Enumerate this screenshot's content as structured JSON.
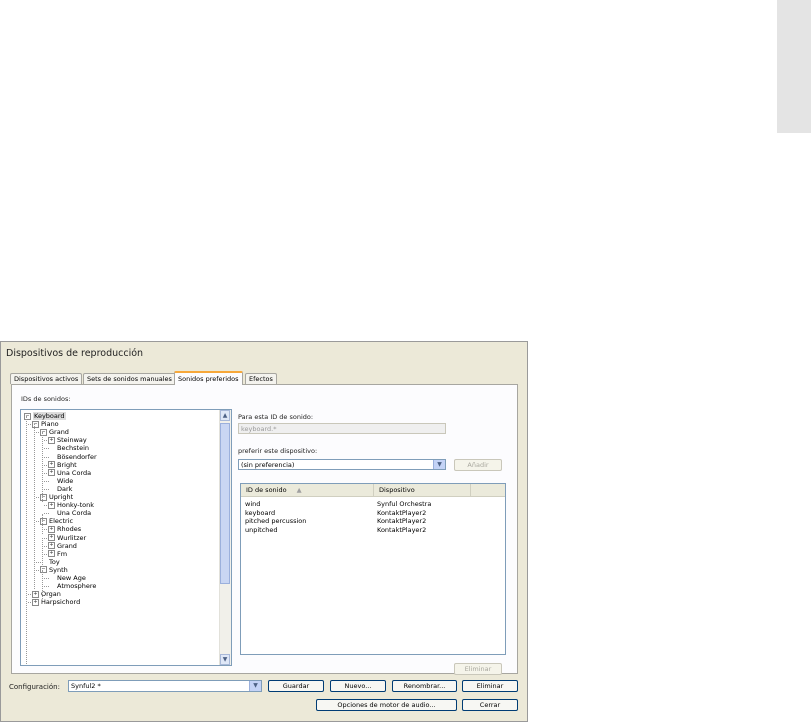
{
  "dialog": {
    "title": "Dispositivos de reproducción",
    "tabs": [
      {
        "label": "Dispositivos activos",
        "active": false
      },
      {
        "label": "Sets de sonidos manuales",
        "active": false
      },
      {
        "label": "Sonidos preferidos",
        "active": true
      },
      {
        "label": "Efectos",
        "active": false
      }
    ],
    "ids_label": "IDs de sonidos:",
    "tree": [
      {
        "label": "Keyboard",
        "depth": 0,
        "expander": "-",
        "selected": true
      },
      {
        "label": "Piano",
        "depth": 1,
        "expander": "-"
      },
      {
        "label": "Grand",
        "depth": 2,
        "expander": "-"
      },
      {
        "label": "Steinway",
        "depth": 3,
        "expander": "+"
      },
      {
        "label": "Bechstein",
        "depth": 3,
        "expander": ""
      },
      {
        "label": "Bösendorfer",
        "depth": 3,
        "expander": ""
      },
      {
        "label": "Bright",
        "depth": 3,
        "expander": "+"
      },
      {
        "label": "Una Corda",
        "depth": 3,
        "expander": "+"
      },
      {
        "label": "Wide",
        "depth": 3,
        "expander": ""
      },
      {
        "label": "Dark",
        "depth": 3,
        "expander": ""
      },
      {
        "label": "Upright",
        "depth": 2,
        "expander": "-"
      },
      {
        "label": "Honky-tonk",
        "depth": 3,
        "expander": "+"
      },
      {
        "label": "Una Corda",
        "depth": 3,
        "expander": ""
      },
      {
        "label": "Electric",
        "depth": 2,
        "expander": "-"
      },
      {
        "label": "Rhodes",
        "depth": 3,
        "expander": "+"
      },
      {
        "label": "Wurlitzer",
        "depth": 3,
        "expander": "+"
      },
      {
        "label": "Grand",
        "depth": 3,
        "expander": "+"
      },
      {
        "label": "Fm",
        "depth": 3,
        "expander": "+"
      },
      {
        "label": "Toy",
        "depth": 2,
        "expander": ""
      },
      {
        "label": "Synth",
        "depth": 2,
        "expander": "-"
      },
      {
        "label": "New Age",
        "depth": 3,
        "expander": ""
      },
      {
        "label": "Atmosphere",
        "depth": 3,
        "expander": ""
      },
      {
        "label": "Organ",
        "depth": 1,
        "expander": "+"
      },
      {
        "label": "Harpsichord",
        "depth": 1,
        "expander": "+"
      }
    ],
    "sound_id_label": "Para esta ID de sonido:",
    "sound_id_value": "keyboard.*",
    "prefer_label": "preferir este dispositivo:",
    "prefer_value": "(sin preferencia)",
    "add_button": "Añadir",
    "columns": [
      "ID de sonido",
      "Dispositivo"
    ],
    "sort_icon": "sort-up-icon",
    "rows": [
      {
        "id": "wind",
        "device": "Synful Orchestra"
      },
      {
        "id": "keyboard",
        "device": "KontaktPlayer2"
      },
      {
        "id": "pitched percussion",
        "device": "KontaktPlayer2"
      },
      {
        "id": "unpitched",
        "device": "KontaktPlayer2"
      }
    ],
    "delete_button": "Eliminar",
    "config_label": "Configuración:",
    "config_value": "Synful2 *",
    "buttons": {
      "save": "Guardar",
      "new": "Nuevo...",
      "rename": "Renombrar...",
      "delete": "Eliminar",
      "audio_options": "Opciones de motor de audio...",
      "close": "Cerrar"
    },
    "colors": {
      "active_tab_accent": "#f7a83a",
      "button_border": "#003c74",
      "field_border": "#7f9db9"
    }
  }
}
